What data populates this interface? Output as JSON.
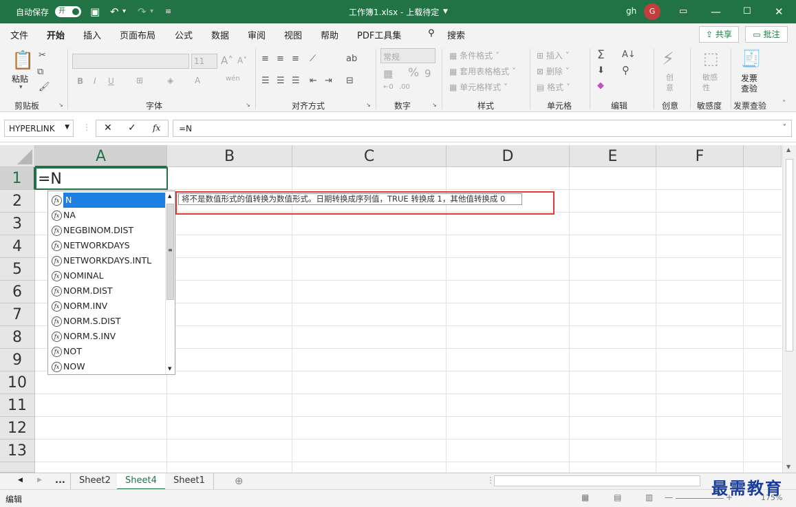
{
  "titlebar": {
    "autosave_label": "自动保存",
    "autosave_state": "开",
    "doc_title": "工作簿1.xlsx - 上载待定",
    "user_initials": "gh",
    "avatar_letter": "G"
  },
  "tabs": [
    "文件",
    "开始",
    "插入",
    "页面布局",
    "公式",
    "数据",
    "审阅",
    "视图",
    "帮助",
    "PDF工具集"
  ],
  "search_label": "搜索",
  "share_label": "共享",
  "comment_label": "批注",
  "ribbon": {
    "clipboard": {
      "paste": "粘贴",
      "label": "剪贴板"
    },
    "font": {
      "size": "11",
      "label": "字体",
      "bold": "B",
      "italic": "I",
      "underline": "U"
    },
    "alignment": {
      "label": "对齐方式"
    },
    "number": {
      "format": "常规",
      "label": "数字"
    },
    "styles": {
      "cond": "条件格式",
      "table": "套用表格格式",
      "cell": "单元格样式",
      "label": "样式"
    },
    "cells": {
      "insert": "插入",
      "delete": "删除",
      "format": "格式",
      "label": "单元格"
    },
    "editing": {
      "label": "编辑"
    },
    "creative": {
      "btn": "创意",
      "label": "创意"
    },
    "sensitivity": {
      "btn": "敏感性",
      "label": "敏感度"
    },
    "invoice": {
      "btn1": "发票",
      "btn2": "查验",
      "label": "发票查验"
    }
  },
  "formula_bar": {
    "name_box": "HYPERLINK",
    "formula": "=N"
  },
  "columns": [
    "A",
    "B",
    "C",
    "D",
    "E",
    "F"
  ],
  "rows": [
    "1",
    "2",
    "3",
    "4",
    "5",
    "6",
    "7",
    "8",
    "9",
    "10",
    "11",
    "12",
    "13"
  ],
  "active_cell_text": "=N",
  "autocomplete": [
    "N",
    "NA",
    "NEGBINOM.DIST",
    "NETWORKDAYS",
    "NETWORKDAYS.INTL",
    "NOMINAL",
    "NORM.DIST",
    "NORM.INV",
    "NORM.S.DIST",
    "NORM.S.INV",
    "NOT",
    "NOW"
  ],
  "tooltip": "将不是数值形式的值转换为数值形式。日期转换成序列值，TRUE 转换成 1，其他值转换成 0",
  "sheets": [
    "...",
    "Sheet2",
    "Sheet4",
    "Sheet1"
  ],
  "status": {
    "mode": "编辑",
    "zoom": "175%"
  },
  "watermark": "最需教育",
  "colors": {
    "accent": "#217346",
    "highlight": "#e53935",
    "selection": "#1e7fe3"
  }
}
